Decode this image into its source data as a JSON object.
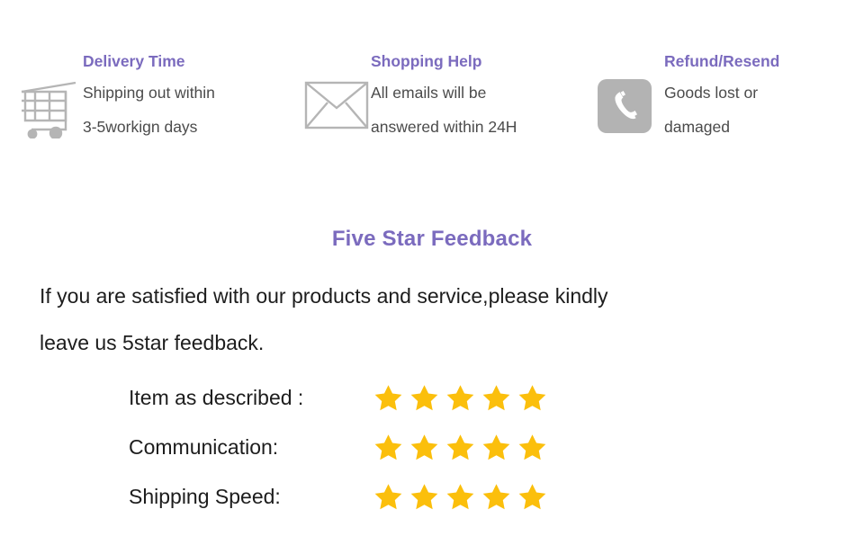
{
  "colors": {
    "heading_purple": "#7b6bbe",
    "body_gray": "#4b4b4b",
    "body_dark": "#1d1d1d",
    "icon_gray": "#b3b3b3",
    "star_gold": "#fbbf0c",
    "background": "#ffffff"
  },
  "services": [
    {
      "icon": "shopping-cart-icon",
      "title": "Delivery Time",
      "lines": [
        "Shipping out within",
        "3-5workign days"
      ]
    },
    {
      "icon": "envelope-icon",
      "title": "Shopping Help",
      "lines": [
        "All emails will be",
        "answered within 24H"
      ]
    },
    {
      "icon": "phone-icon",
      "title": "Refund/Resend",
      "lines": [
        "Goods lost or",
        "damaged"
      ]
    }
  ],
  "feedback": {
    "title": "Five Star Feedback",
    "paragraph_lines": [
      "If you are satisfied with our products and service,please kindly",
      "leave us 5star feedback."
    ],
    "ratings": [
      {
        "label": "Item as described :",
        "stars": 5
      },
      {
        "label": "Communication:",
        "stars": 5
      },
      {
        "label": "Shipping Speed:",
        "stars": 5
      }
    ]
  }
}
